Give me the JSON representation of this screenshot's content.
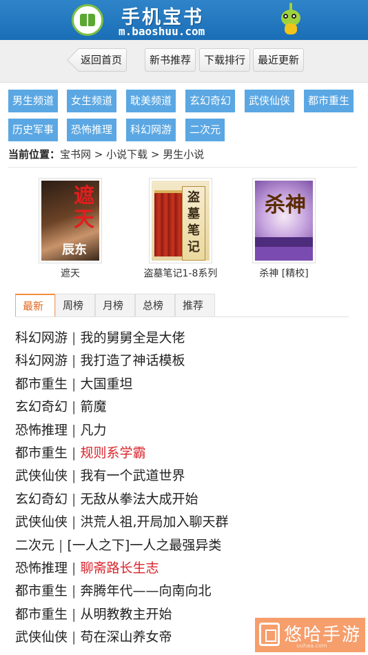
{
  "header": {
    "site_name": "手机宝书",
    "site_url": "m.baoshuu.com"
  },
  "nav": {
    "back_label": "返回首页",
    "buttons": [
      "新书推荐",
      "下载排行",
      "最近更新"
    ]
  },
  "categories": [
    "男生频道",
    "女生频道",
    "耽美频道",
    "玄幻奇幻",
    "武侠仙侠",
    "都市重生",
    "历史军事",
    "恐怖推理",
    "科幻网游",
    "二次元"
  ],
  "location": {
    "label": "当前位置：",
    "path": "宝书网 > 小说下载 > 男生小说"
  },
  "featured": [
    {
      "title": "遮天",
      "cover_text": "遮天",
      "cover_author": "辰东"
    },
    {
      "title": "盗墓笔记1-8系列",
      "cover_text": "盗墓笔记"
    },
    {
      "title": "杀神 [精校]",
      "cover_text": "杀神"
    }
  ],
  "tabs": [
    "最新",
    "周榜",
    "月榜",
    "总榜",
    "推荐"
  ],
  "active_tab": "最新",
  "list": [
    {
      "category": "科幻网游",
      "title": "我的舅舅全是大佬",
      "highlight": false
    },
    {
      "category": "科幻网游",
      "title": "我打造了神话模板",
      "highlight": false
    },
    {
      "category": "都市重生",
      "title": "大国重坦",
      "highlight": false
    },
    {
      "category": "玄幻奇幻",
      "title": "箭魔",
      "highlight": false
    },
    {
      "category": "恐怖推理",
      "title": "凡力",
      "highlight": false
    },
    {
      "category": "都市重生",
      "title": "规则系学霸",
      "highlight": true
    },
    {
      "category": "武侠仙侠",
      "title": "我有一个武道世界",
      "highlight": false
    },
    {
      "category": "玄幻奇幻",
      "title": "无敌从拳法大成开始",
      "highlight": false
    },
    {
      "category": "武侠仙侠",
      "title": "洪荒人祖,开局加入聊天群",
      "highlight": false
    },
    {
      "category": "二次元",
      "title": "[一人之下]一人之最强异类",
      "highlight": false
    },
    {
      "category": "恐怖推理",
      "title": "聊斋路长生志",
      "highlight": true
    },
    {
      "category": "都市重生",
      "title": "奔腾年代——向南向北",
      "highlight": false
    },
    {
      "category": "都市重生",
      "title": "从明教教主开始",
      "highlight": false
    },
    {
      "category": "武侠仙侠",
      "title": "苟在深山养女帝",
      "highlight": false
    }
  ],
  "list_separator": " | ",
  "colors": {
    "header_blue": "#1f76bd",
    "category_blue": "#5aa7e3",
    "active_tab_orange": "#e2651c",
    "highlight_red": "#d9232b"
  },
  "watermark": {
    "text": "悠哈手游",
    "sub": "uuhaa.com"
  }
}
